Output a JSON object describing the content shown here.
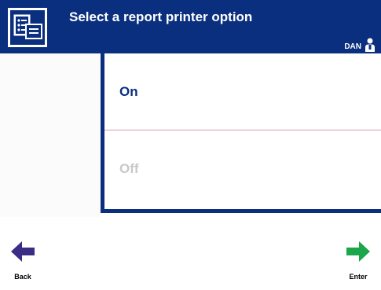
{
  "header": {
    "title": "Select a report printer option",
    "username": "DAN",
    "icon": "printer-report-icon",
    "user_icon": "user-icon",
    "background_color": "#0b2f7f"
  },
  "options": [
    {
      "label": "On",
      "state": "enabled"
    },
    {
      "label": "Off",
      "state": "disabled"
    }
  ],
  "footer": {
    "back_label": "Back",
    "enter_label": "Enter",
    "back_icon": "arrow-left-icon",
    "enter_icon": "arrow-right-icon",
    "back_color": "#3b2c86",
    "enter_color": "#1aa64a"
  }
}
